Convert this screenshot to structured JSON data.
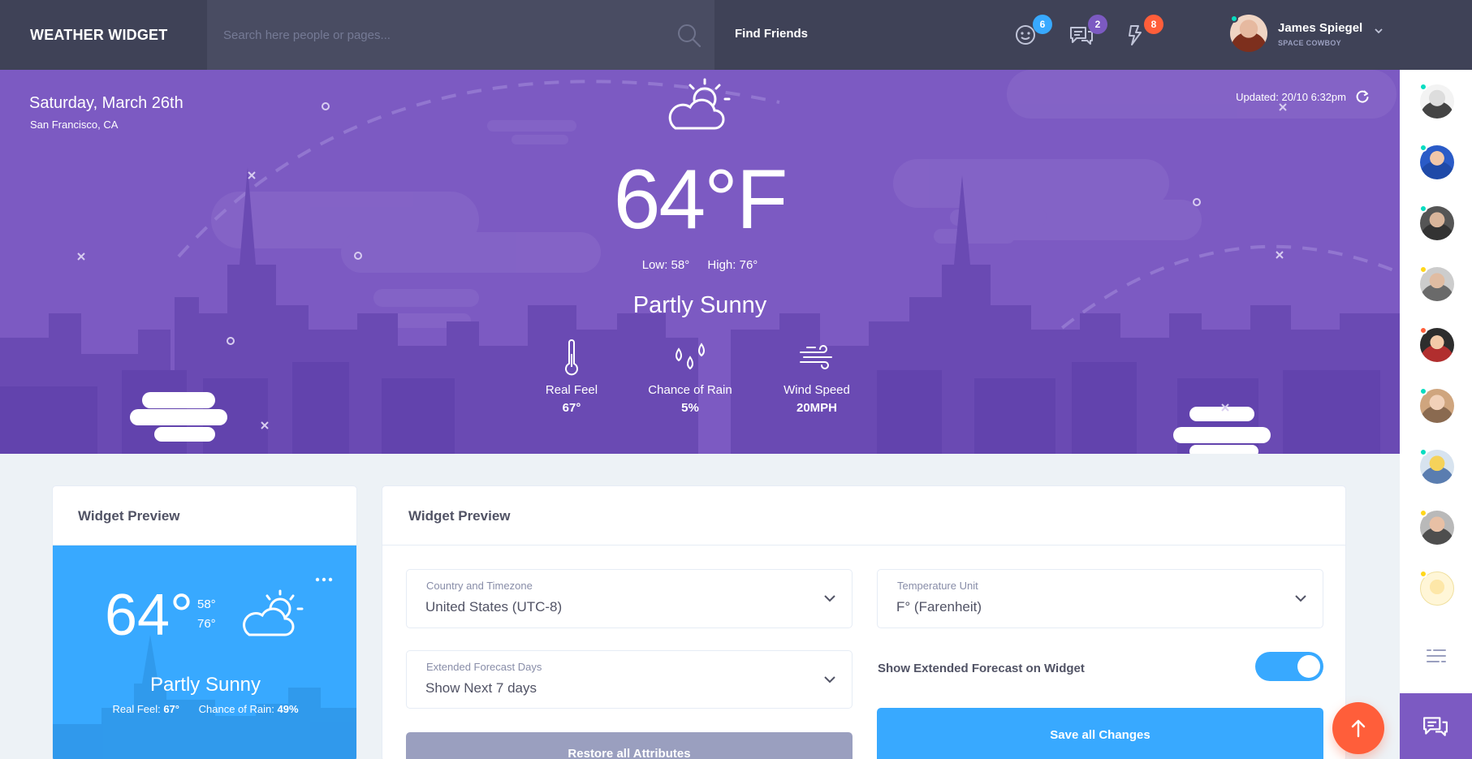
{
  "header": {
    "brand": "WEATHER WIDGET",
    "search_placeholder": "Search here people or pages...",
    "find_friends": "Find Friends",
    "badges": {
      "friend_requests": "6",
      "messages": "2",
      "notifications": "8"
    },
    "badge_colors": {
      "friend_requests": "#38a9ff",
      "messages": "#7c5ac2",
      "notifications": "#ff5e3a"
    },
    "user": {
      "name": "James Spiegel",
      "subtitle": "SPACE COWBOY"
    }
  },
  "hero": {
    "date": "Saturday, March 26th",
    "location": "San Francisco, CA",
    "updated": "Updated: 20/10 6:32pm",
    "temperature": "64°F",
    "low": "Low: 58°",
    "high": "High: 76°",
    "condition": "Partly Sunny",
    "stats": [
      {
        "label": "Real Feel",
        "value": "67°",
        "icon": "thermometer-icon"
      },
      {
        "label": "Chance of Rain",
        "value": "5%",
        "icon": "rain-drops-icon"
      },
      {
        "label": "Wind Speed",
        "value": "20MPH",
        "icon": "wind-icon"
      }
    ],
    "background": "#7c5ac2"
  },
  "widget_preview_card": {
    "title": "Widget Preview",
    "temp": "64°",
    "low": "58°",
    "high": "76°",
    "condition": "Partly Sunny",
    "real_feel_label": "Real Feel:",
    "real_feel_value": "67°",
    "rain_label": "Chance of Rain:",
    "rain_value": "49%",
    "background": "#38a9ff"
  },
  "settings_card": {
    "title": "Widget Preview",
    "country": {
      "label": "Country and Timezone",
      "value": "United States (UTC-8)"
    },
    "unit": {
      "label": "Temperature Unit",
      "value": "F° (Farenheit)"
    },
    "forecast_days": {
      "label": "Extended Forecast Days",
      "value": "Show Next 7 days"
    },
    "toggle_label": "Show Extended Forecast on Widget",
    "toggle_on": true,
    "save_button": "Save all Changes",
    "restore_button": "Restore all Attributes"
  },
  "right_sidebar": {
    "online_status_colors": [
      "#08ddc1",
      "#08ddc1",
      "#08ddc1",
      "#ffd71b",
      "#ff5e3a",
      "#08ddc1",
      "#08ddc1",
      "#ffd71b",
      "#ffd71b"
    ]
  }
}
